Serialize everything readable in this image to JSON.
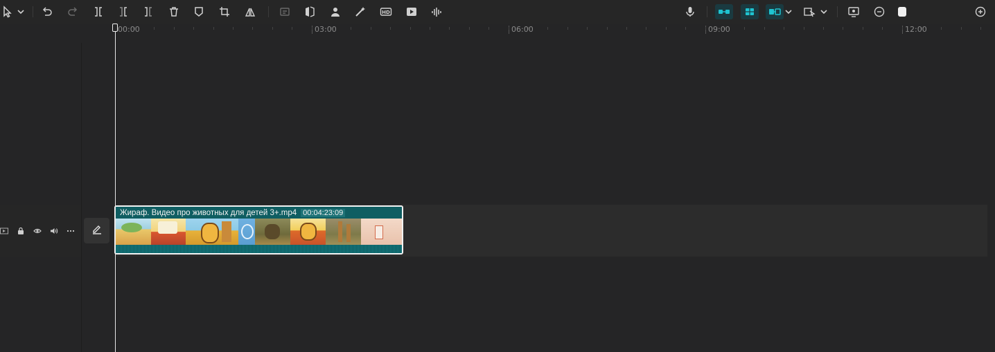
{
  "toolbar": {
    "left_tools": [
      "select-icon",
      "undo-icon",
      "redo-icon",
      "split-icon",
      "split-left-icon",
      "split-right-icon",
      "delete-icon",
      "mark-icon",
      "crop-icon",
      "mirror-icon",
      "freeze-icon",
      "flip-icon",
      "person-icon",
      "magic-icon",
      "hd-icon",
      "record-icon",
      "audio-split-icon"
    ],
    "right_tools": [
      "mic-icon",
      "link-icon",
      "magnet-icon",
      "connect-icon",
      "preview-icon",
      "screen-icon",
      "zoom-out-icon",
      "zoom-in-icon"
    ],
    "accent": "#1fc3d0"
  },
  "ruler": {
    "labels": [
      "00:00",
      "03:00",
      "06:00",
      "09:00",
      "12:00"
    ]
  },
  "track": {
    "controls": [
      "track-type-icon",
      "lock-icon",
      "eye-icon",
      "volume-icon",
      "more-icon"
    ],
    "edit_icon": "pencil-icon"
  },
  "clip": {
    "name": "Жираф. Видео про животных для детей 3+.mp4",
    "duration": "00:04:23:09"
  }
}
